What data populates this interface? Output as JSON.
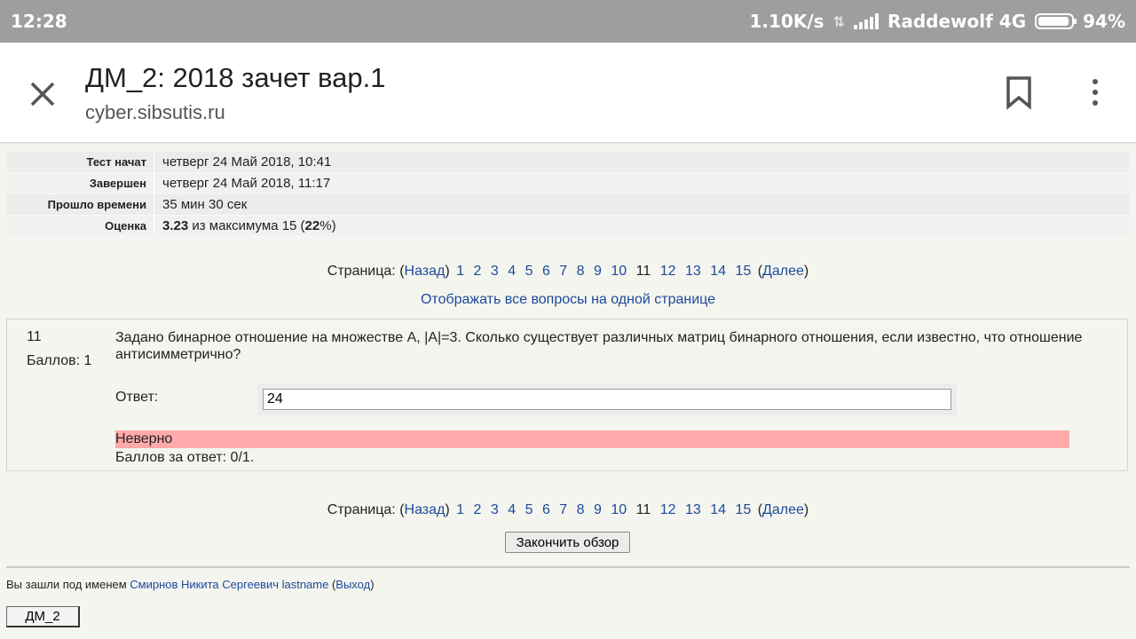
{
  "status_bar": {
    "time": "12:28",
    "net_speed": "1.10K/s",
    "carrier": "Raddewolf 4G",
    "battery": "94%",
    "battery_level": 0.94
  },
  "app_bar": {
    "title": "ДМ_2: 2018 зачет вар.1",
    "url": "cyber.sibsutis.ru"
  },
  "summary": [
    {
      "label": "Тест начат",
      "value": "четверг 24 Май 2018, 10:41"
    },
    {
      "label": "Завершен",
      "value": "четверг 24 Май 2018, 11:17"
    },
    {
      "label": "Прошло времени",
      "value": "35 мин 30 сек"
    }
  ],
  "grade": {
    "label": "Оценка",
    "score": "3.23",
    "mid": " из максимума 15 (",
    "percent": "22",
    "tail": "%)"
  },
  "paging": {
    "label": "Страница: (",
    "prev": "Назад",
    "next": "Далее",
    "close": ")",
    "open": "(",
    "pages": [
      "1",
      "2",
      "3",
      "4",
      "5",
      "6",
      "7",
      "8",
      "9",
      "10",
      "11",
      "12",
      "13",
      "14",
      "15"
    ],
    "current": "11"
  },
  "show_all": "Отображать все вопросы на одной странице",
  "question": {
    "number": "11",
    "points": "Баллов: 1",
    "text": "Задано бинарное отношение на множестве А, |A|=3. Сколько существует различных матриц бинарного отношения, если известно, что отношение антисимметрично?",
    "answer_label": "Ответ:",
    "answer_value": "24",
    "feedback": "Неверно",
    "score": "Баллов за ответ: 0/1."
  },
  "finish_button": "Закончить обзор",
  "login": {
    "prefix": "Вы зашли под именем ",
    "user": "Смирнов Никита Сергеевич lastname",
    "open": " (",
    "logout": "Выход",
    "close": ")"
  },
  "course_button": "ДМ_2"
}
